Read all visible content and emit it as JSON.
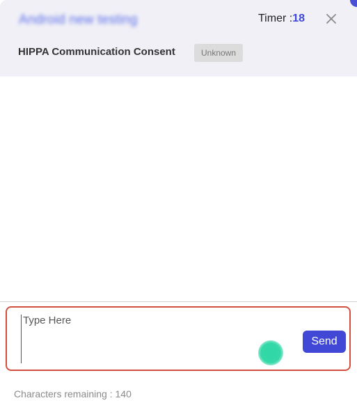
{
  "header": {
    "contact_name": "Android new testing",
    "timer_label": "Timer :",
    "timer_value": "18",
    "close_icon": "close-icon",
    "consent_label": "HIPPA Communication Consent",
    "consent_status": "Unknown"
  },
  "composer": {
    "placeholder": "Type Here",
    "value": "",
    "send_label": "Send",
    "status_indicator": "green-status-dot"
  },
  "footer": {
    "chars_remaining_label": "Characters remaining : ",
    "chars_remaining_value": "140"
  },
  "colors": {
    "accent": "#4148d6",
    "timer_value": "#3d4ad9",
    "header_bg": "#f1f0f7",
    "composer_border": "#d24f3e",
    "status_dot": "#2fd6a4"
  }
}
